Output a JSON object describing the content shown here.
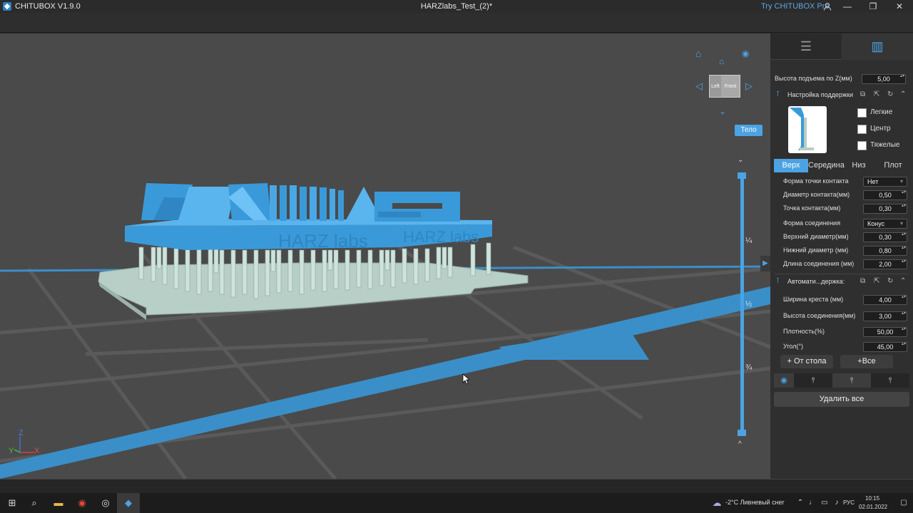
{
  "window": {
    "app_name": "CHITUBOX V1.9.0",
    "document_title": "HARZlabs_Test_(2)*",
    "try_pro": "Try CHITUBOX Pro",
    "min": "—",
    "max": "❐",
    "close": "✕"
  },
  "viewport": {
    "body_button": "Тело",
    "cube_left": "Left",
    "cube_front": "Front",
    "slider_ticks": [
      "¼",
      "½",
      "¾"
    ],
    "model_text": "HARZ labs",
    "axis_x": "X",
    "axis_y": "Y",
    "axis_z": "Z"
  },
  "panel": {
    "lift_height_label": "Высота подъема по Z(мм)",
    "lift_height_value": "5,00",
    "support_settings_title": "Настройка поддержки",
    "presets": [
      "Легкие",
      "Центр",
      "Тяжелые"
    ],
    "subtabs": [
      "Верх",
      "Середина",
      "Низ",
      "Плот"
    ],
    "top": [
      {
        "label": "Форма точки контакта",
        "value": "Нет",
        "type": "select"
      },
      {
        "label": "Диаметр контакта(мм)",
        "value": "0,50",
        "type": "spin"
      },
      {
        "label": "Точка контакта(мм)",
        "value": "0,30",
        "type": "spin"
      },
      {
        "label": "Форма соединения",
        "value": "Конус",
        "type": "select"
      },
      {
        "label": "Верхний диаметр(мм)",
        "value": "0,30",
        "type": "spin"
      },
      {
        "label": "Нижний диаметр (мм)",
        "value": "0,80",
        "type": "spin"
      },
      {
        "label": "Длина соединения (мм)",
        "value": "2,00",
        "type": "spin"
      }
    ],
    "auto_support_title": "Автомати...держка:",
    "auto": [
      {
        "label": "Ширина креста (мм)",
        "value": "4,00"
      },
      {
        "label": "Высота соединения(мм)",
        "value": "3,00"
      },
      {
        "label": "Плотность(%)",
        "value": "50,00"
      },
      {
        "label": "Угол(°)",
        "value": "45,00"
      }
    ],
    "from_platform": "+ От стола",
    "all": "+Все",
    "delete_all": "Удалить все"
  },
  "taskbar": {
    "weather": "-2°C  Ливневый снег",
    "lang": "РУС",
    "time": "10:15",
    "date": "02.01.2022"
  },
  "colors": {
    "accent": "#4ba3e3",
    "model": "#3a9ad9",
    "support": "#cfe3dd",
    "raft": "#b7cfc6"
  }
}
